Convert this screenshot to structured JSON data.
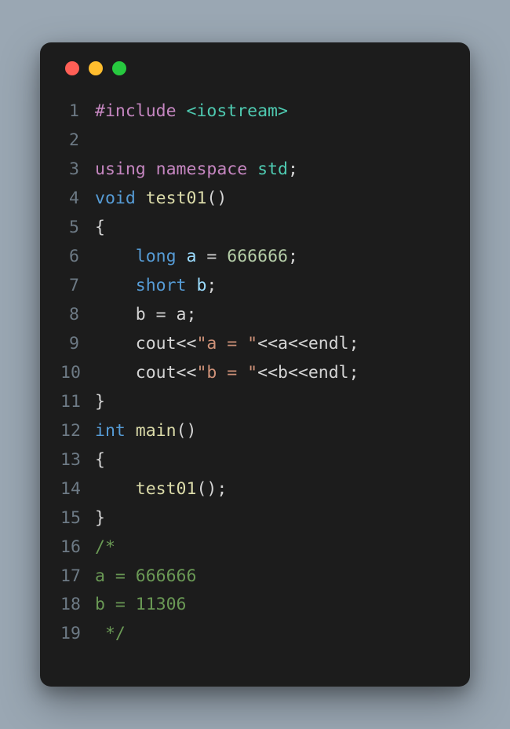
{
  "window": {
    "traffic_lights": [
      "close",
      "minimize",
      "zoom"
    ]
  },
  "code": {
    "lines": [
      {
        "n": "1",
        "tokens": [
          {
            "t": "#include ",
            "c": "c-purple"
          },
          {
            "t": "<iostream>",
            "c": "c-teal"
          }
        ]
      },
      {
        "n": "2",
        "tokens": [
          {
            "t": "",
            "c": "c-plain"
          }
        ]
      },
      {
        "n": "3",
        "tokens": [
          {
            "t": "using ",
            "c": "c-purple"
          },
          {
            "t": "namespace ",
            "c": "c-purple"
          },
          {
            "t": "std",
            "c": "c-teal"
          },
          {
            "t": ";",
            "c": "c-plain"
          }
        ]
      },
      {
        "n": "4",
        "tokens": [
          {
            "t": "void ",
            "c": "c-blue"
          },
          {
            "t": "test01",
            "c": "c-fn"
          },
          {
            "t": "()",
            "c": "c-plain"
          }
        ]
      },
      {
        "n": "5",
        "tokens": [
          {
            "t": "{",
            "c": "c-plain"
          }
        ]
      },
      {
        "n": "6",
        "tokens": [
          {
            "t": "    ",
            "c": "c-plain"
          },
          {
            "t": "long ",
            "c": "c-blue"
          },
          {
            "t": "a ",
            "c": "c-var"
          },
          {
            "t": "= ",
            "c": "c-plain"
          },
          {
            "t": "666666",
            "c": "c-num"
          },
          {
            "t": ";",
            "c": "c-plain"
          }
        ]
      },
      {
        "n": "7",
        "tokens": [
          {
            "t": "    ",
            "c": "c-plain"
          },
          {
            "t": "short ",
            "c": "c-blue"
          },
          {
            "t": "b",
            "c": "c-var"
          },
          {
            "t": ";",
            "c": "c-plain"
          }
        ]
      },
      {
        "n": "8",
        "tokens": [
          {
            "t": "    b = a;",
            "c": "c-plain"
          }
        ]
      },
      {
        "n": "9",
        "tokens": [
          {
            "t": "    cout<<",
            "c": "c-plain"
          },
          {
            "t": "\"a = \"",
            "c": "c-str"
          },
          {
            "t": "<<a<<endl;",
            "c": "c-plain"
          }
        ]
      },
      {
        "n": "10",
        "tokens": [
          {
            "t": "    cout<<",
            "c": "c-plain"
          },
          {
            "t": "\"b = \"",
            "c": "c-str"
          },
          {
            "t": "<<b<<endl;",
            "c": "c-plain"
          }
        ]
      },
      {
        "n": "11",
        "tokens": [
          {
            "t": "}",
            "c": "c-plain"
          }
        ]
      },
      {
        "n": "12",
        "tokens": [
          {
            "t": "int ",
            "c": "c-blue"
          },
          {
            "t": "main",
            "c": "c-fn"
          },
          {
            "t": "()",
            "c": "c-plain"
          }
        ]
      },
      {
        "n": "13",
        "tokens": [
          {
            "t": "{",
            "c": "c-plain"
          }
        ]
      },
      {
        "n": "14",
        "tokens": [
          {
            "t": "    ",
            "c": "c-plain"
          },
          {
            "t": "test01",
            "c": "c-fn"
          },
          {
            "t": "();",
            "c": "c-plain"
          }
        ]
      },
      {
        "n": "15",
        "tokens": [
          {
            "t": "}",
            "c": "c-plain"
          }
        ]
      },
      {
        "n": "16",
        "tokens": [
          {
            "t": "/*",
            "c": "c-comment"
          }
        ]
      },
      {
        "n": "17",
        "tokens": [
          {
            "t": "a = 666666",
            "c": "c-comment"
          }
        ]
      },
      {
        "n": "18",
        "tokens": [
          {
            "t": "b = 11306",
            "c": "c-comment"
          }
        ]
      },
      {
        "n": "19",
        "tokens": [
          {
            "t": " */",
            "c": "c-comment"
          }
        ]
      }
    ]
  }
}
